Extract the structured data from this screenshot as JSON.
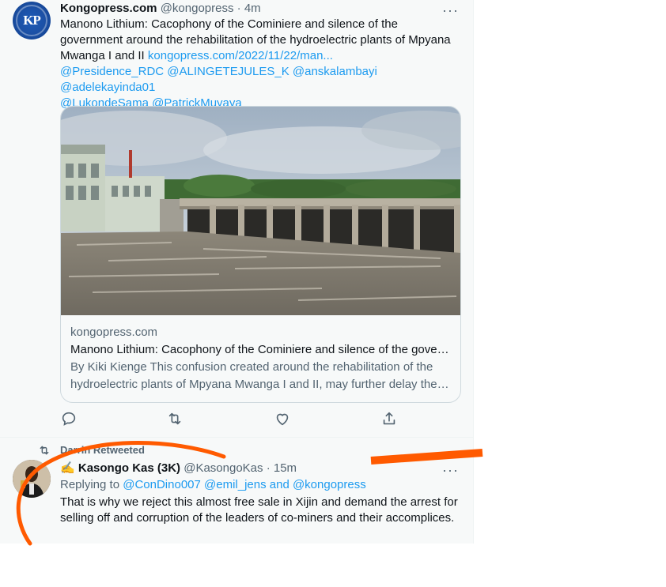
{
  "tweet1": {
    "avatar_text": "KP",
    "name": "Kongopress.com",
    "handle": "@kongopress",
    "sep": "·",
    "time": "4m",
    "more": "···",
    "text": "Manono Lithium: Cacophony of the Cominiere and silence of the government around the rehabilitation of the hydroelectric plants of Mpyana Mwanga I and II",
    "url": "kongopress.com/2022/11/22/man...",
    "mentions_line1": "@Presidence_RDC @ALINGETEJULES_K @anskalambayi @adelekayinda01",
    "mentions_line2": "@LukondeSama @PatrickMuyaya",
    "card": {
      "domain": "kongopress.com",
      "title": "Manono Lithium: Cacophony of the Cominiere and silence of the gove…",
      "desc_line1": "By Kiki Kienge This confusion created around the rehabilitation of the",
      "desc_line2": "hydroelectric plants of Mpyana Mwanga I and II, may further delay the…"
    },
    "actions": [
      "reply-icon",
      "retweet-icon",
      "like-icon",
      "share-icon"
    ]
  },
  "tweet2": {
    "retweeted_by": "Darrin Retweeted",
    "name_emoji": "✍",
    "name": "Kasongo Kas (3K)",
    "handle": "@KasongoKas",
    "sep": "·",
    "time": "15m",
    "more": "···",
    "replying_prefix": "Replying to",
    "replying_to": "@ConDino007 @emil_jens and @kongopress",
    "text": "That is why we reject this almost free sale in Xijin and demand the arrest for selling off and corruption of the leaders of co-miners and their accomplices."
  },
  "colors": {
    "link": "#1d9bf0",
    "muted": "#536471",
    "annotation": "#ff5a00"
  }
}
